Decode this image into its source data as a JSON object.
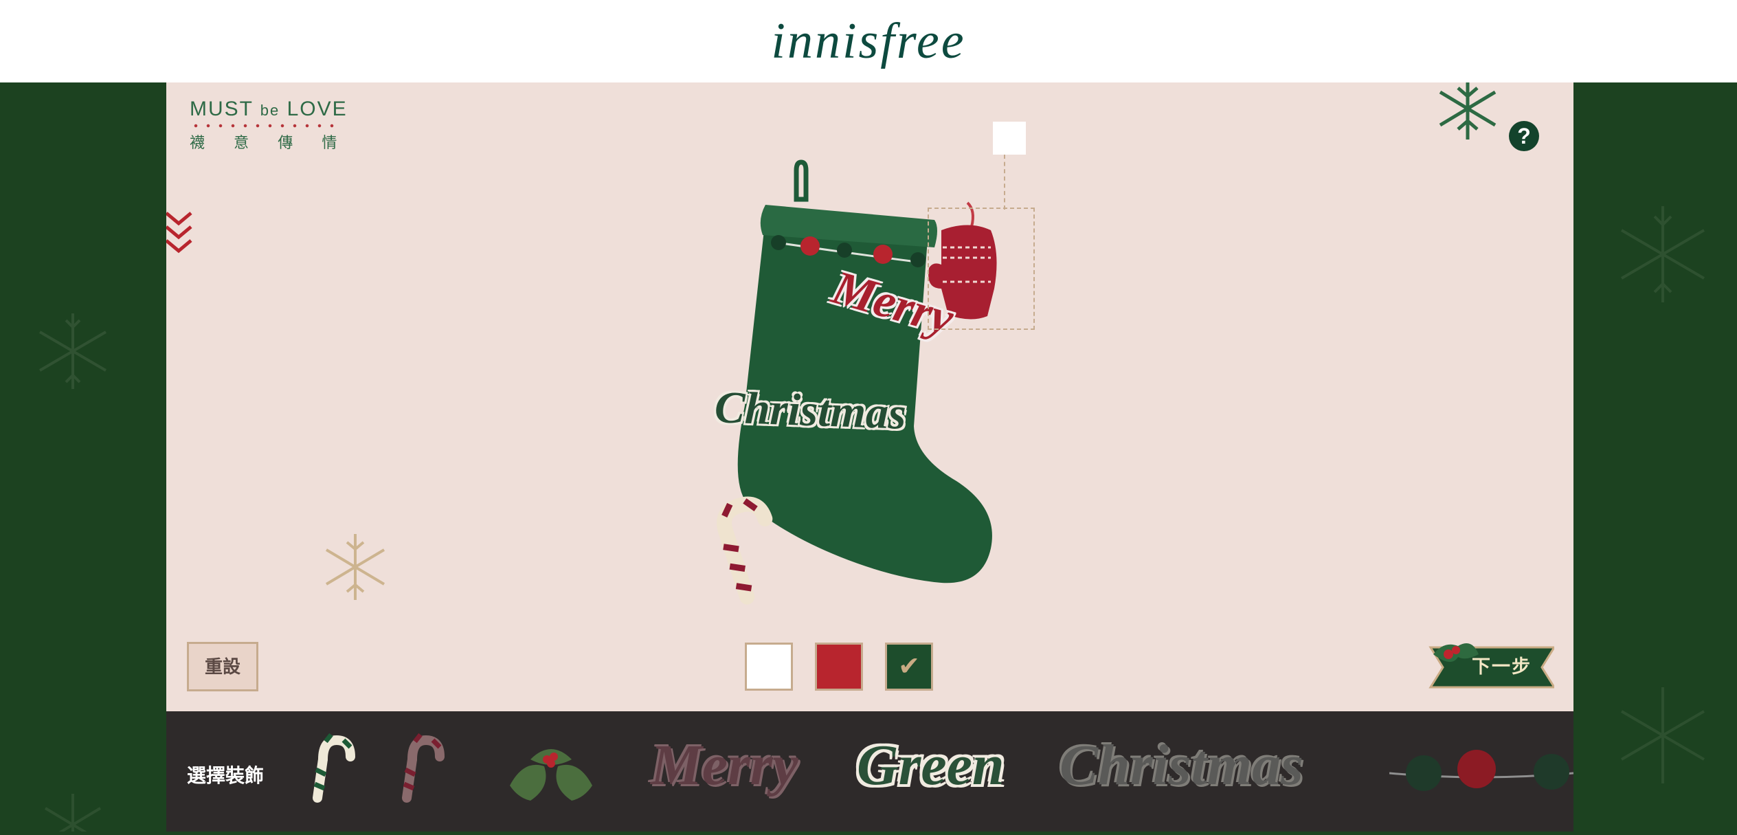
{
  "header": {
    "logo": "innisfree"
  },
  "campaign": {
    "title_must": "MUST",
    "title_be": "be",
    "title_love": "LOVE",
    "subtitle": "襪 意 傳 情"
  },
  "help": {
    "label": "?"
  },
  "stage": {
    "stickers": [
      {
        "id": "merry",
        "text": "Merry",
        "color": "#a8202e"
      },
      {
        "id": "christmas",
        "text": "Christmas",
        "color": "#244d34"
      }
    ]
  },
  "colors": {
    "options": [
      {
        "name": "white",
        "value": "#ffffff",
        "selected": false
      },
      {
        "name": "red",
        "value": "#b8252e",
        "selected": false
      },
      {
        "name": "green",
        "value": "#1d4d2c",
        "selected": true
      }
    ],
    "selected_check": "✔"
  },
  "controls": {
    "reset_label": "重設",
    "next_label": "下一步"
  },
  "tray": {
    "label": "選擇裝飾",
    "items": [
      {
        "id": "candy-cane-green",
        "icon": "candy-cane-icon"
      },
      {
        "id": "candy-cane-red",
        "icon": "candy-cane-icon"
      },
      {
        "id": "holly",
        "icon": "holly-icon"
      },
      {
        "id": "sticker-merry",
        "text": "Merry"
      },
      {
        "id": "sticker-green",
        "text": "Green"
      },
      {
        "id": "sticker-christmas",
        "text": "Christmas"
      },
      {
        "id": "pompom-garland",
        "icon": "pompom-garland-icon"
      }
    ]
  }
}
